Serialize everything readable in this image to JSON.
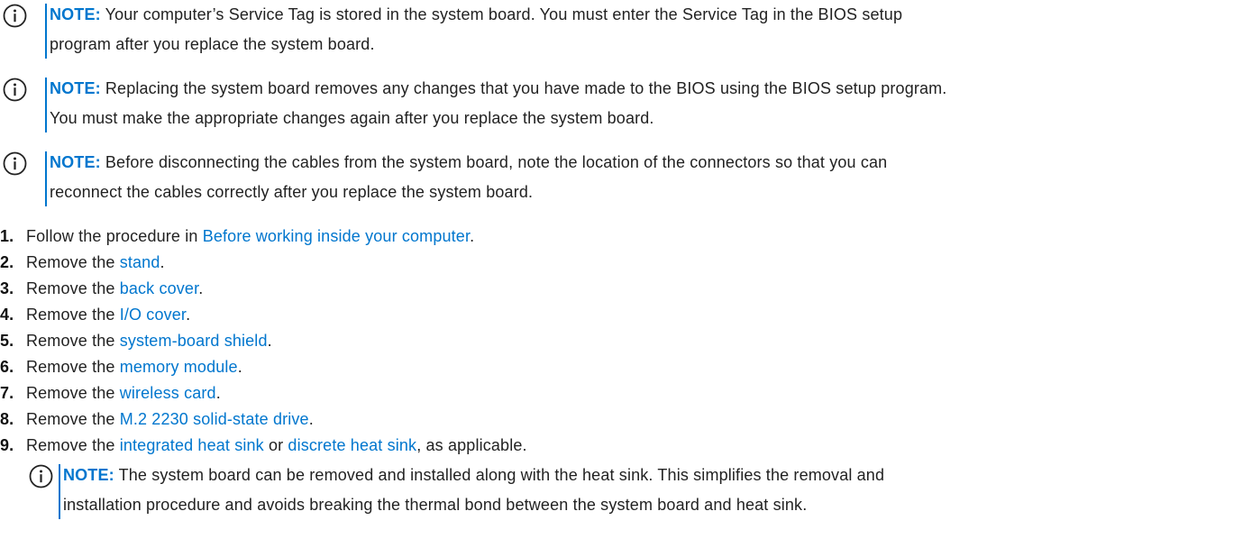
{
  "notes": [
    {
      "label": "NOTE:",
      "line1": " Your computer’s Service Tag is stored in the system board. You must enter the Service Tag in the BIOS setup",
      "line2": "program after you replace the system board."
    },
    {
      "label": "NOTE:",
      "line1": " Replacing the system board removes any changes that you have made to the BIOS using the BIOS setup program.",
      "line2": "You must make the appropriate changes again after you replace the system board."
    },
    {
      "label": "NOTE:",
      "line1": " Before disconnecting the cables from the system board, note the location of the connectors so that you can",
      "line2": "reconnect the cables correctly after you replace the system board."
    }
  ],
  "steps": [
    {
      "num": "1.",
      "pre": "Follow the procedure in ",
      "link": "Before working inside your computer",
      "post": "."
    },
    {
      "num": "2.",
      "pre": "Remove the ",
      "link": "stand",
      "post": "."
    },
    {
      "num": "3.",
      "pre": "Remove the ",
      "link": "back cover",
      "post": "."
    },
    {
      "num": "4.",
      "pre": "Remove the ",
      "link": "I/O cover",
      "post": "."
    },
    {
      "num": "5.",
      "pre": "Remove the ",
      "link": "system-board shield",
      "post": "."
    },
    {
      "num": "6.",
      "pre": "Remove the ",
      "link": "memory module",
      "post": "."
    },
    {
      "num": "7.",
      "pre": "Remove the ",
      "link": "wireless card",
      "post": "."
    },
    {
      "num": "8.",
      "pre": "Remove the ",
      "link": "M.2 2230 solid-state drive",
      "post": "."
    }
  ],
  "step9": {
    "num": "9.",
    "pre": "Remove the ",
    "link1": "integrated heat sink",
    "mid": " or ",
    "link2": "discrete heat sink",
    "post": ", as applicable."
  },
  "sub_note": {
    "label": "NOTE:",
    "line1": " The system board can be removed and installed along with the heat sink. This simplifies the removal and",
    "line2": "installation procedure and avoids breaking the thermal bond between the system board and heat sink."
  },
  "icon": "info-circle-icon",
  "colors": {
    "accent": "#0076ce",
    "text": "#222222"
  }
}
